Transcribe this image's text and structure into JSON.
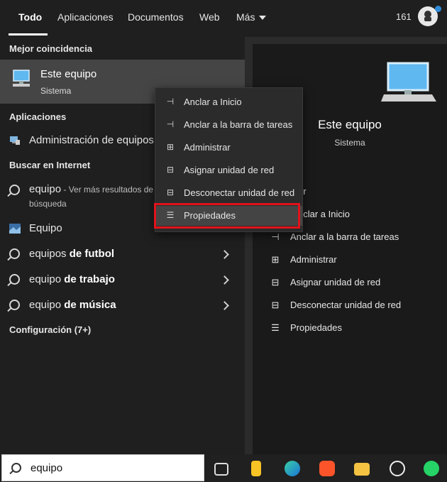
{
  "tabs": [
    {
      "label": "Todo"
    },
    {
      "label": "Aplicaciones"
    },
    {
      "label": "Documentos"
    },
    {
      "label": "Web"
    },
    {
      "label": "Más"
    }
  ],
  "header": {
    "points": "161"
  },
  "left": {
    "best_match_heading": "Mejor coincidencia",
    "best_match": {
      "title": "Este equipo",
      "subtitle": "Sistema",
      "icon": "pc-icon"
    },
    "apps_heading": "Aplicaciones",
    "apps": [
      {
        "label": "Administración de equipos",
        "icon": "computer-management-icon"
      }
    ],
    "web_heading": "Buscar en Internet",
    "web_results": [
      {
        "term": "equipo",
        "suffix": " - Ver más resultados de",
        "line2": "búsqueda"
      },
      {
        "term": "Equipo",
        "suffix": ""
      },
      {
        "term": "equipos",
        "bold": " de futbol"
      },
      {
        "term": "equipo",
        "bold": " de trabajo"
      },
      {
        "term": "equipo",
        "bold": " de música"
      }
    ],
    "settings_heading": "Configuración (7+)"
  },
  "context_menu": {
    "items": [
      {
        "label": "Anclar a Inicio",
        "icon": "pin-icon"
      },
      {
        "label": "Anclar a la barra de tareas",
        "icon": "pin-taskbar-icon"
      },
      {
        "label": "Administrar",
        "icon": "manage-icon"
      },
      {
        "label": "Asignar unidad de red",
        "icon": "map-drive-icon"
      },
      {
        "label": "Desconectar unidad de red",
        "icon": "disconnect-drive-icon"
      },
      {
        "label": "Propiedades",
        "icon": "properties-icon"
      }
    ]
  },
  "preview": {
    "title": "Este equipo",
    "subtitle": "Sistema",
    "actions": [
      {
        "label": "Abrir",
        "visible": "rir",
        "icon": "open-icon"
      },
      {
        "label": "Anclar a Inicio",
        "visible": "nclar a Inicio",
        "icon": "pin-icon"
      },
      {
        "label": "Anclar a la barra de tareas",
        "icon": "pin-taskbar-icon"
      },
      {
        "label": "Administrar",
        "icon": "manage-icon"
      },
      {
        "label": "Asignar unidad de red",
        "icon": "map-drive-icon"
      },
      {
        "label": "Desconectar unidad de red",
        "icon": "disconnect-drive-icon"
      },
      {
        "label": "Propiedades",
        "icon": "properties-icon"
      }
    ]
  },
  "taskbar": {
    "search_value": "equipo",
    "apps": [
      "task-view-icon",
      "keep-icon",
      "edge-icon",
      "brave-icon",
      "file-explorer-icon",
      "chatgpt-icon",
      "whatsapp-icon"
    ]
  },
  "colors": {
    "accent": "#2f8bd8",
    "highlight": "#e0121b",
    "hover": "#454545"
  }
}
